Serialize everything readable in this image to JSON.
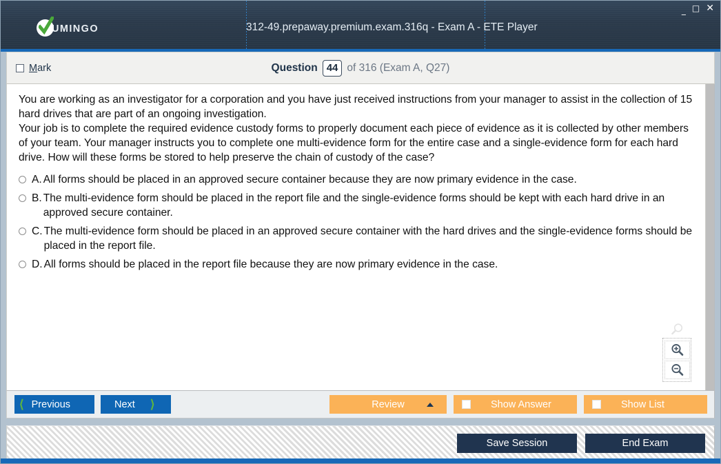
{
  "window": {
    "app_title": "312-49.prepaway.premium.exam.316q - Exam A - ETE Player",
    "logo_wordmark": "UMINGO",
    "controls": {
      "minimize": "_",
      "maximize": "□",
      "close": "✕"
    }
  },
  "question_header": {
    "mark_label_prefix": "",
    "mark_label": "Mark",
    "mark_accel": "M",
    "mark_rest": "ark",
    "counter_label": "Question",
    "question_number": "44",
    "counter_suffix": "of 316 (Exam A, Q27)"
  },
  "question": {
    "paragraph_1": "You are working as an investigator for a corporation and you have just received instructions from your manager to assist in the collection of 15 hard drives that are part of an ongoing investigation.",
    "paragraph_2": "Your job is to complete the required evidence custody forms to properly document each piece of evidence as it is collected by other members of your team. Your manager instructs you to complete one multi-evidence form for the entire case and a single-evidence form for each hard drive. How will these forms be stored to help preserve the chain of custody of the case?"
  },
  "answers": [
    {
      "letter": "A.",
      "text": "All forms should be placed in an approved secure container because they are now primary evidence in the case.",
      "selected": false
    },
    {
      "letter": "B.",
      "text": "The multi-evidence form should be placed in the report file and the single-evidence forms should be kept with each hard drive in an approved secure container.",
      "selected": false
    },
    {
      "letter": "C.",
      "text": "The multi-evidence form should be placed in an approved secure container with the hard drives and the single-evidence forms should be placed in the report file.",
      "selected": false
    },
    {
      "letter": "D.",
      "text": "All forms should be placed in the report file because they are now primary evidence in the case.",
      "selected": false
    }
  ],
  "zoom_tools": {
    "ghost_icon": "magnifier-icon",
    "zoom_in_icon": "zoom-in-icon",
    "zoom_out_icon": "zoom-out-icon"
  },
  "action_bar": {
    "previous_label": "Previous",
    "next_label": "Next",
    "review_label": "Review",
    "show_answer_label": "Show Answer",
    "show_list_label": "Show List"
  },
  "footer": {
    "save_session_label": "Save Session",
    "end_exam_label": "End Exam"
  },
  "colors": {
    "title_bar": "#2b3a4b",
    "accent_blue": "#1769b8",
    "nav_button": "#0f66b4",
    "chevron_green": "#5fb83c",
    "orange_button": "#fbb257",
    "footer_button": "#20344f",
    "logo_check_green": "#4aa83a"
  }
}
